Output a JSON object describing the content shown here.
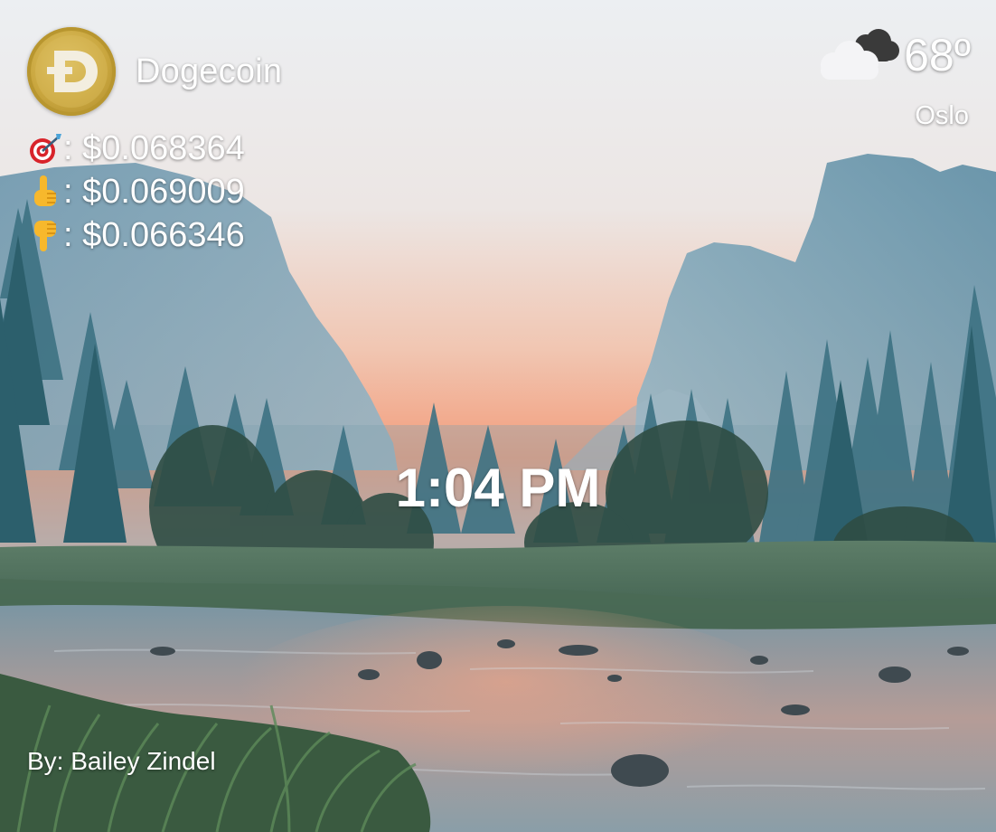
{
  "coin": {
    "name": "Dogecoin",
    "logo": "dogecoin-logo"
  },
  "prices": [
    {
      "icon": "direct-hit-dart-icon",
      "value": ": $0.068364"
    },
    {
      "icon": "pointing-up-hand-icon",
      "value": ": $0.069009"
    },
    {
      "icon": "pointing-down-hand-icon",
      "value": ": $0.066346"
    }
  ],
  "weather": {
    "icon": "partly-cloudy-icon",
    "temperature": "68º",
    "city": "Oslo"
  },
  "clock": {
    "time": "1:04 PM"
  },
  "footer": {
    "credit": "By: Bailey Zindel"
  },
  "colors": {
    "text": "#ffffff",
    "coin_gold": "#c9a63e",
    "sky_top": "#eef1f4",
    "sky_glow": "#f2a07e",
    "mountain": "#7d9fb3",
    "forest": "#2f6470",
    "water": "#6f8b99"
  }
}
